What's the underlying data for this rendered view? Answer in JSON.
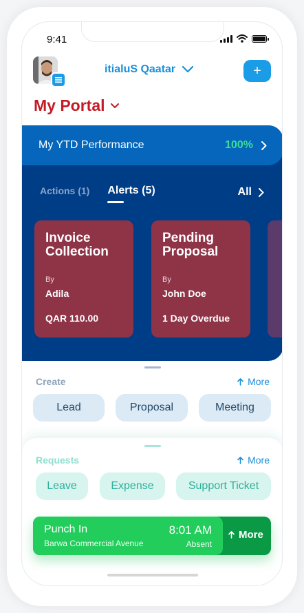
{
  "status_bar": {
    "time": "9:41"
  },
  "header": {
    "company_name": "itialuS Qaatar",
    "add_label": "+",
    "portal_title": "My Portal"
  },
  "ytd": {
    "label": "My YTD Performance",
    "value": "100%"
  },
  "tabs": {
    "actions": "Actions (1)",
    "alerts": "Alerts (5)",
    "all": "All"
  },
  "alerts": [
    {
      "title_line1": "Invoice",
      "title_line2": "Collection",
      "by_label": "By",
      "person": "Adila",
      "meta": "QAR 110.00"
    },
    {
      "title_line1": "Pending",
      "title_line2": "Proposal",
      "by_label": "By",
      "person": "John Doe",
      "meta": "1 Day Overdue"
    }
  ],
  "create": {
    "label": "Create",
    "more": "More",
    "items": [
      "Lead",
      "Proposal",
      "Meeting"
    ]
  },
  "requests": {
    "label": "Requests",
    "more": "More",
    "items": [
      "Leave",
      "Expense",
      "Support Ticket"
    ]
  },
  "punch": {
    "title": "Punch In",
    "location": "Barwa Commercial Avenue",
    "time": "8:01 AM",
    "status": "Absent",
    "more": "More"
  },
  "colors": {
    "brand_blue": "#1a9ce6",
    "portal_red": "#c31c25",
    "panel_navy": "#003d87",
    "alert_card": "#8f3347",
    "punch_green": "#22cd5c"
  }
}
